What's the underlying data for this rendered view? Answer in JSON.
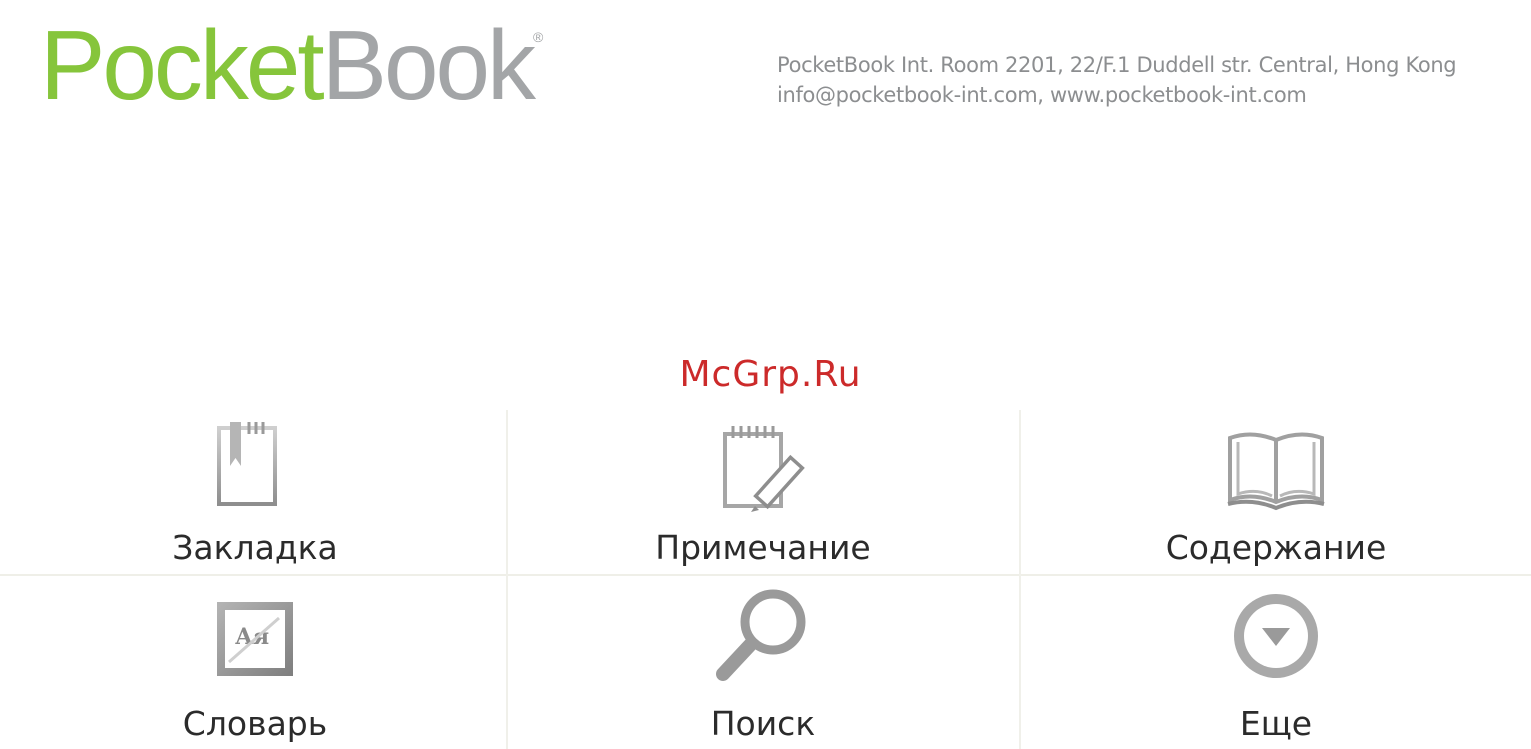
{
  "header": {
    "logo_part1": "Pocket",
    "logo_part2": "Book",
    "logo_reg": "®",
    "address_line": "PocketBook Int. Room 2201, 22/F.1 Duddell str. Central, Hong Kong",
    "contact_line": "info@pocketbook-int.com, www.pocketbook-int.com"
  },
  "watermark": "McGrp.Ru",
  "colors": {
    "brand_green": "#86c53b",
    "brand_gray": "#a3a5a7",
    "watermark_red": "#cc2a2a",
    "icon_gray": "#9a9a9a"
  },
  "menu": {
    "items": [
      {
        "label": "Закладка",
        "icon": "bookmark-icon"
      },
      {
        "label": "Примечание",
        "icon": "note-pencil-icon"
      },
      {
        "label": "Содержание",
        "icon": "open-book-icon"
      },
      {
        "label": "Словарь",
        "icon": "dictionary-icon"
      },
      {
        "label": "Поиск",
        "icon": "magnifier-icon"
      },
      {
        "label": "Еще",
        "icon": "more-down-arrow-icon"
      }
    ]
  }
}
